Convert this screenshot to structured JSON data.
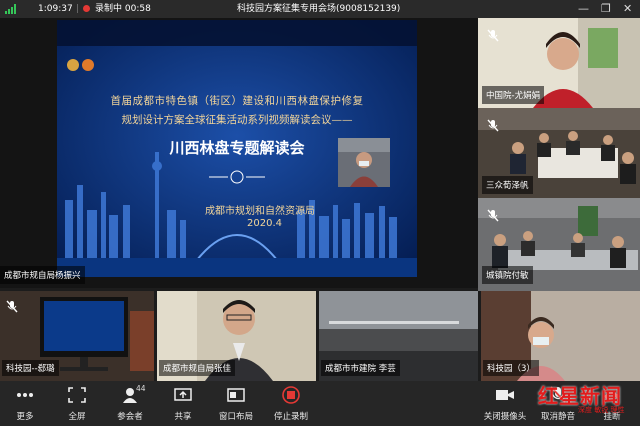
{
  "status": {
    "time": "1:09:37",
    "recording_label": "录制中",
    "recording_time": "00:58",
    "meeting_title": "科技园方案征集专用会场(9008152139)"
  },
  "slide": {
    "line1": "首届成都市特色镇（街区）建设和川西林盘保护修复",
    "line2": "规划设计方案全球征集活动系列视频解读会议——",
    "headline": "川西林盘专题解读会",
    "org": "成都市规划和自然资源局",
    "date": "2020.4"
  },
  "main_label": "成都市规自局杨振兴",
  "tiles": [
    {
      "label": "中国院-尤娟娟"
    },
    {
      "label": "三众荀泽帆"
    },
    {
      "label": "城镇院付敏"
    }
  ],
  "thumbs": [
    {
      "label": "科技园--郄璐"
    },
    {
      "label": "成都市规自局张佳"
    },
    {
      "label": "成都市市建院 李芸"
    },
    {
      "label": "科技园（3）"
    }
  ],
  "toolbar": {
    "more": "更多",
    "fullscreen": "全屏",
    "participants": "参会者",
    "participants_count": "44",
    "share": "共享",
    "layout": "窗口布局",
    "stop_record": "停止录制",
    "camera_off": "关闭摄像头",
    "unmute": "取消静音",
    "hangup": "挂断"
  },
  "watermark": {
    "brand": "红星新闻",
    "sub": "深度 敏锐 理性"
  },
  "colors": {
    "accent": "#2f8cff",
    "record": "#e53935",
    "slide_bg": "#062a6a",
    "slide_text": "#f2d59a"
  }
}
